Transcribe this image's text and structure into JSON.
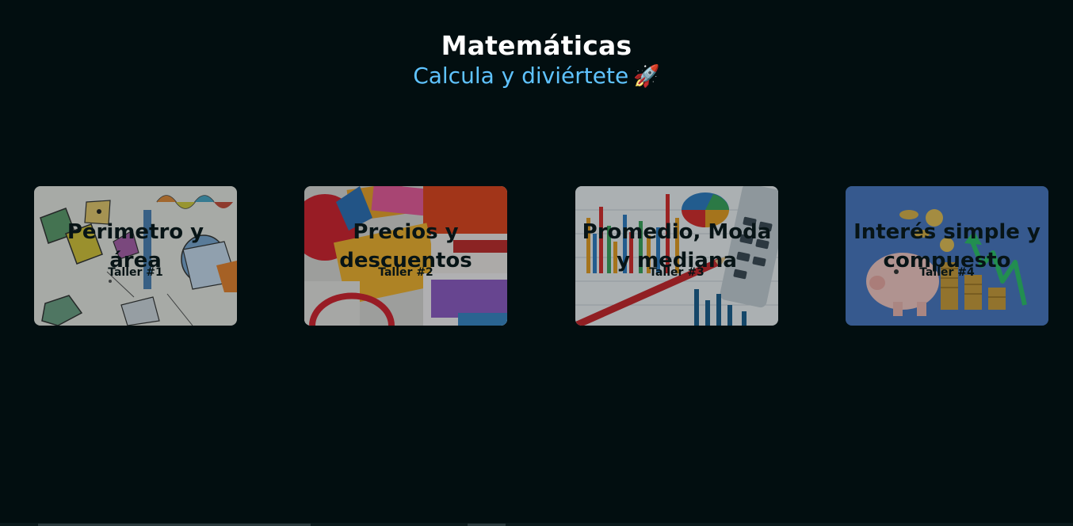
{
  "header": {
    "title": "Matemáticas",
    "subtitle": "Calcula y diviértete",
    "subtitle_emoji": "🚀"
  },
  "cards": [
    {
      "title": "Perimetro y área",
      "subtitle": "Taller #1",
      "image": "geometry-shapes-collage"
    },
    {
      "title": "Precios y descuentos",
      "subtitle": "Taller #2",
      "image": "sale-discount-tags"
    },
    {
      "title": "Promedio, Moda y mediana",
      "subtitle": "Taller #3",
      "image": "bar-charts-calculator"
    },
    {
      "title": "Interés simple y compuesto",
      "subtitle": "Taller #4",
      "image": "piggy-bank-coins"
    }
  ],
  "colors": {
    "background": "#020e10",
    "title": "#ffffff",
    "subtitle": "#5fc3ff",
    "card_text": "#071416"
  }
}
